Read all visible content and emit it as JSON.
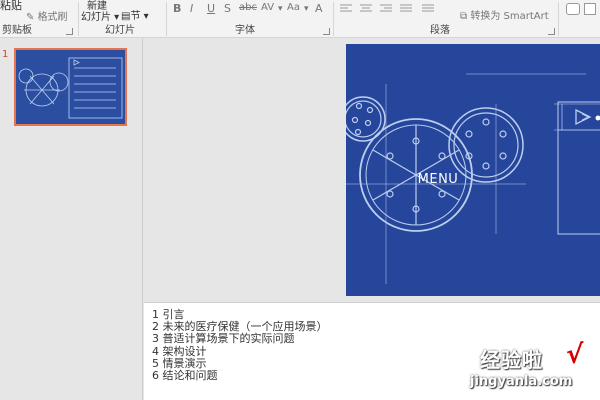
{
  "ribbon": {
    "clipboard": {
      "paste": "粘贴",
      "format_painter": "格式刷",
      "label": "剪贴板"
    },
    "slides": {
      "new_line1": "新建",
      "new_line2": "幻灯片",
      "section": "节",
      "label": "幻灯片"
    },
    "font": {
      "label": "字体",
      "buttons": [
        "B",
        "I",
        "U",
        "S",
        "abc",
        "AV",
        "Aa",
        "A"
      ]
    },
    "paragraph": {
      "label": "段落",
      "smartart": "转换为 SmartArt"
    }
  },
  "thumbnails": {
    "selected_index": "1"
  },
  "slide": {
    "title": "MENU"
  },
  "notes": {
    "lines": [
      "1 引言",
      "2 未来的医疗保健（一个应用场景）",
      "3 普适计算场景下的实际问题",
      "4 架构设计",
      "5 情景演示",
      "6 结论和问题"
    ]
  },
  "watermark": {
    "top": "经验啦",
    "bottom": "jingyanla.com",
    "check": "√"
  },
  "colors": {
    "slide_bg": "#25469a",
    "accent": "#d24726"
  }
}
